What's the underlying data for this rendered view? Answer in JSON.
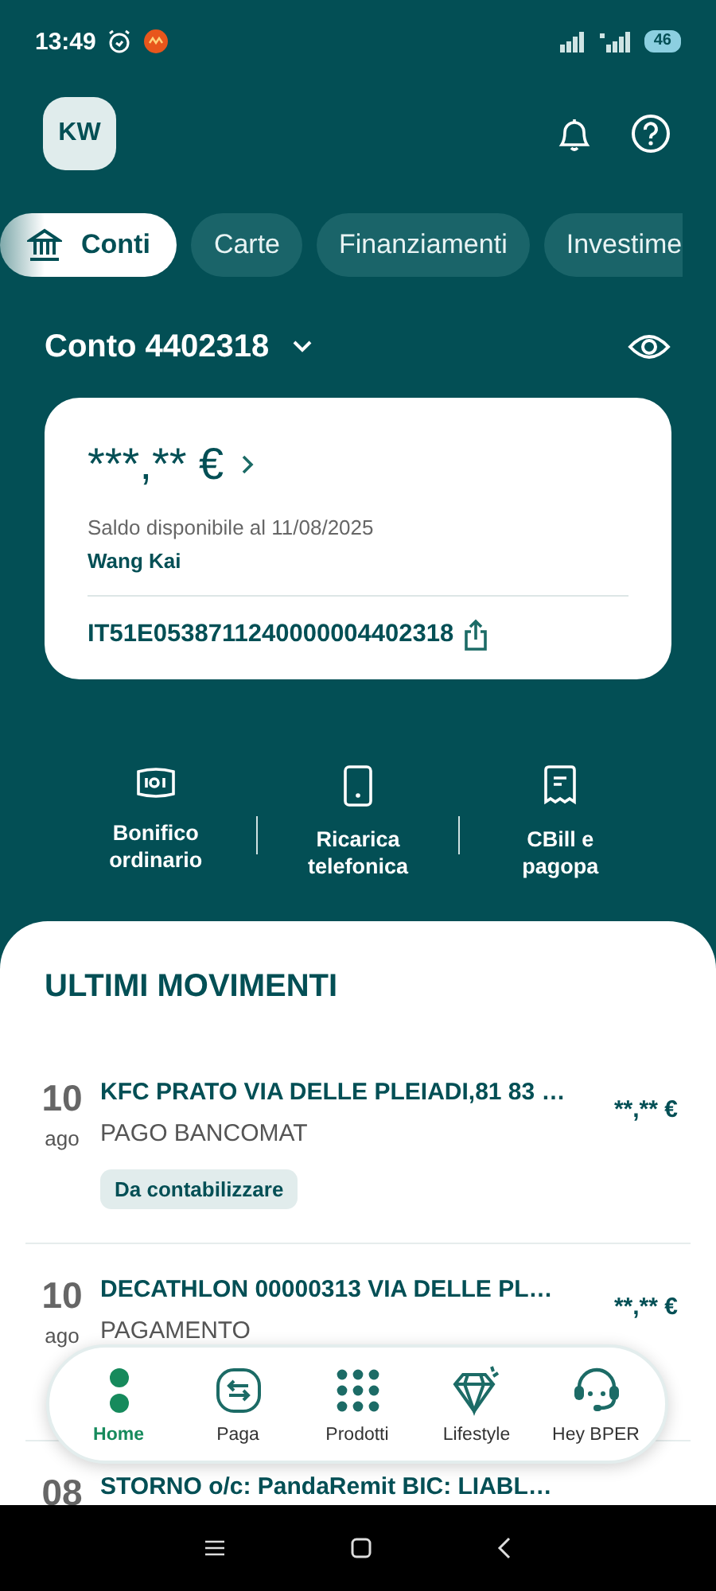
{
  "status_bar": {
    "time": "13:49",
    "battery": "46"
  },
  "header": {
    "avatar": "KW"
  },
  "tabs": [
    {
      "label": "Conti",
      "selected": true
    },
    {
      "label": "Carte",
      "selected": false
    },
    {
      "label": "Finanziamenti",
      "selected": false
    },
    {
      "label": "Investime",
      "selected": false
    }
  ],
  "account": {
    "title": "Conto 4402318",
    "balance": "***,** €",
    "balance_caption": "Saldo disponibile al 11/08/2025",
    "holder": "Wang Kai",
    "iban": "IT51E0538711240000004402318"
  },
  "quick_actions": [
    {
      "label": "Bonifico ordinario"
    },
    {
      "label": "Ricarica telefonica"
    },
    {
      "label": "CBill e pagopa"
    }
  ],
  "movements": {
    "title": "ULTIMI MOVIMENTI",
    "items": [
      {
        "day": "10",
        "month": "ago",
        "description": "KFC PRATO VIA DELLE PLEIADI,81 83 …",
        "type": "PAGO BANCOMAT",
        "amount": "**,** €",
        "tag": "Da contabilizzare"
      },
      {
        "day": "10",
        "month": "ago",
        "description": "DECATHLON 00000313 VIA DELLE PL…",
        "type": "PAGAMENTO",
        "amount": "**,** €"
      },
      {
        "day": "08",
        "description": "STORNO o/c: PandaRemit  BIC: LIABL…"
      }
    ]
  },
  "bottom_nav": [
    {
      "label": "Home",
      "selected": true
    },
    {
      "label": "Paga",
      "selected": false
    },
    {
      "label": "Prodotti",
      "selected": false
    },
    {
      "label": "Lifestyle",
      "selected": false
    },
    {
      "label": "Hey BPER",
      "selected": false
    }
  ]
}
